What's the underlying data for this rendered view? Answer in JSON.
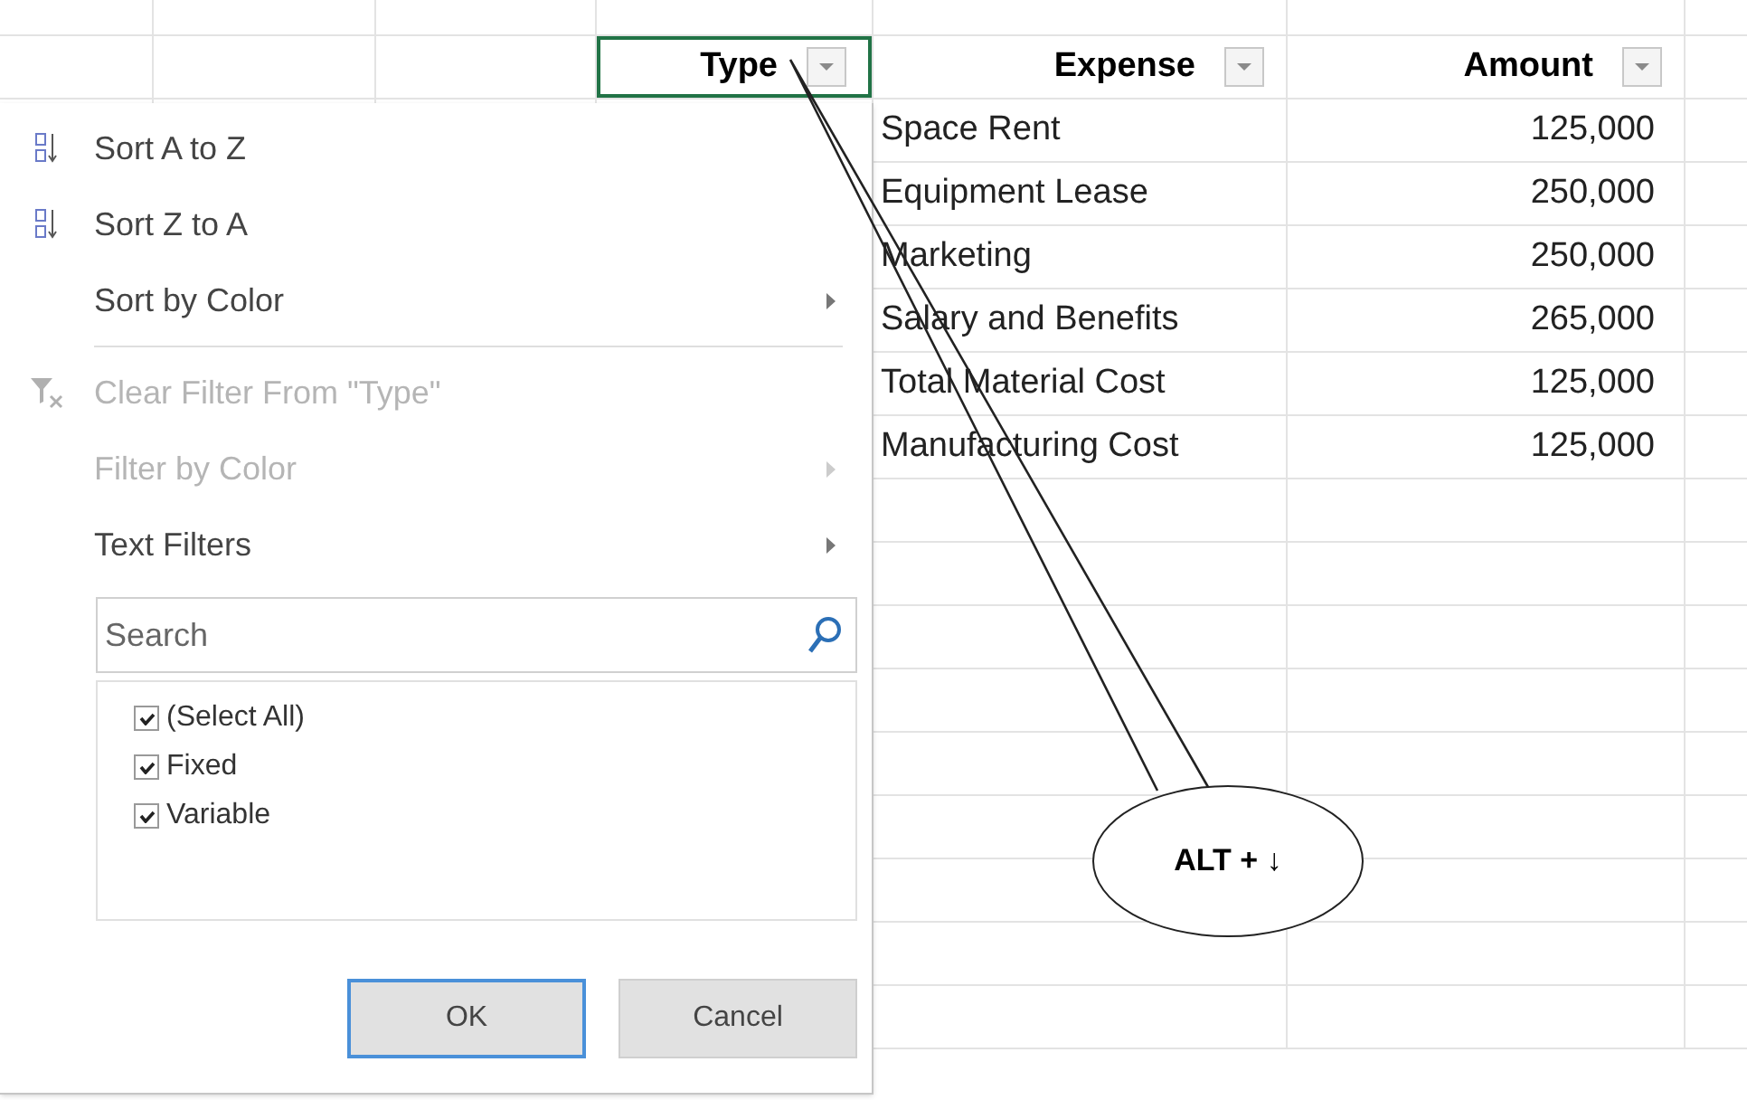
{
  "columns": [
    {
      "label": "Type",
      "active": true
    },
    {
      "label": "Expense",
      "active": false
    },
    {
      "label": "Amount",
      "active": false
    }
  ],
  "rows": [
    {
      "expense": "Space Rent",
      "amount": "125,000"
    },
    {
      "expense": "Equipment Lease",
      "amount": "250,000"
    },
    {
      "expense": "Marketing",
      "amount": "250,000"
    },
    {
      "expense": "Salary and Benefits",
      "amount": "265,000"
    },
    {
      "expense": "Total Material Cost",
      "amount": "125,000"
    },
    {
      "expense": "Manufacturing Cost",
      "amount": "125,000"
    }
  ],
  "filter_menu": {
    "items": [
      {
        "kind": "sort_ascending",
        "label": "Sort A to Z",
        "disabled": false,
        "submenu": false,
        "divider_before": false
      },
      {
        "kind": "sort_descending",
        "label": "Sort Z to A",
        "disabled": false,
        "submenu": false,
        "divider_before": false
      },
      {
        "kind": "plain",
        "label": "Sort by Color",
        "disabled": false,
        "submenu": true,
        "divider_before": false
      },
      {
        "kind": "clear_filter",
        "label": "Clear Filter From \"Type\"",
        "disabled": true,
        "submenu": false,
        "divider_before": true
      },
      {
        "kind": "plain",
        "label": "Filter by Color",
        "disabled": true,
        "submenu": true,
        "divider_before": false
      },
      {
        "kind": "plain",
        "label": "Text Filters",
        "disabled": false,
        "submenu": true,
        "divider_before": false
      }
    ],
    "search": {
      "placeholder": "Search"
    },
    "values": [
      {
        "label": "(Select All)",
        "checked": true
      },
      {
        "label": "Fixed",
        "checked": true
      },
      {
        "label": "Variable",
        "checked": true
      }
    ],
    "buttons": [
      {
        "label": "OK",
        "default": true
      },
      {
        "label": "Cancel",
        "default": false
      }
    ]
  },
  "callout": {
    "text": "ALT + ↓"
  }
}
